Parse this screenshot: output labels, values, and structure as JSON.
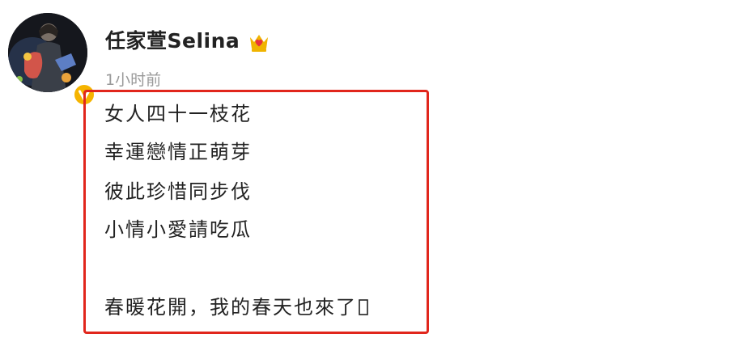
{
  "user": {
    "name": "任家萱Selina",
    "time": "1小时前"
  },
  "post": {
    "lines": [
      "女人四十一枝花",
      "幸運戀情正萌芽",
      "彼此珍惜同步伐",
      "小情小愛請吃瓜",
      "春暖花開，我的春天也來了"
    ]
  },
  "colors": {
    "highlight_border": "#e1261c",
    "verified_badge": "#f5b400",
    "vip_icon": "#f0b400",
    "vip_heart": "#e8323c"
  },
  "icons": {
    "verified": "verified-v-icon",
    "vip": "vip-crown-heart-icon",
    "trailing": "box-placeholder-icon"
  }
}
